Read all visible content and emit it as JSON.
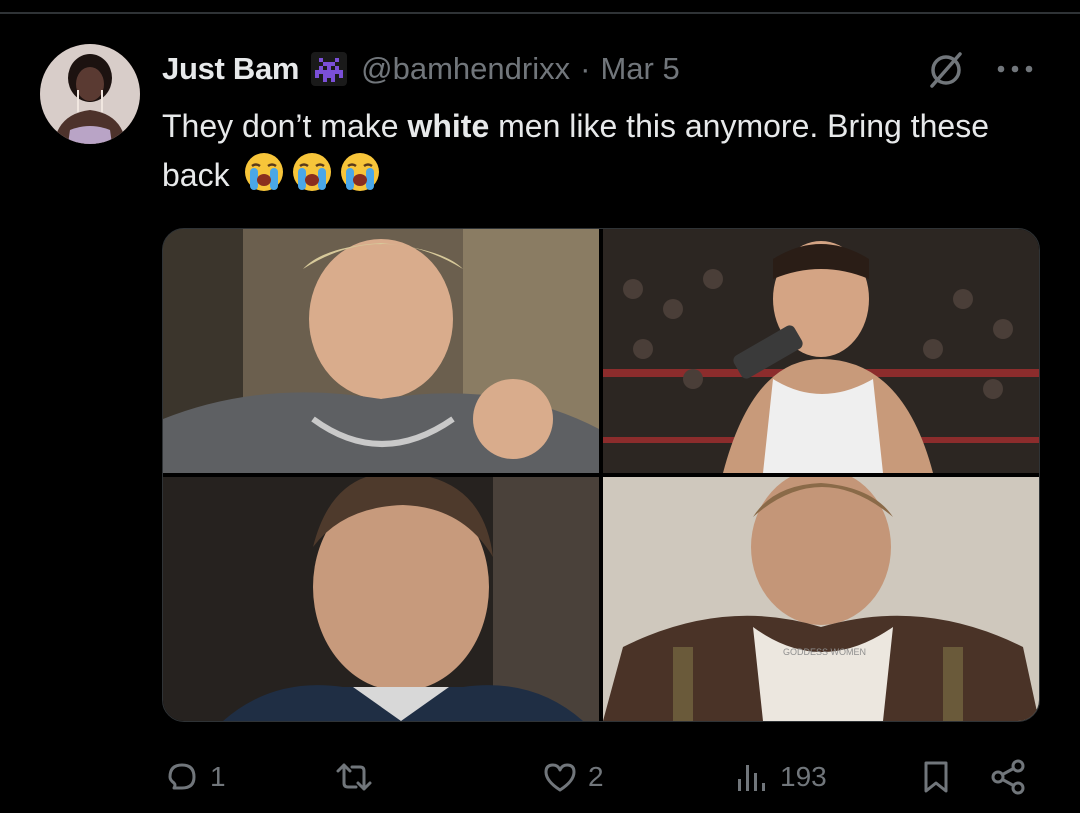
{
  "tweet": {
    "author": {
      "display_name": "Just Bam",
      "badge_icon": "space-invader-icon",
      "handle": "@bamhendrixx",
      "separator": "·",
      "date": "Mar 5"
    },
    "text": {
      "part1": "They don’t make ",
      "bold": "white",
      "part2": " men like this anymore. Bring these back",
      "emojis": [
        "loudly-crying-face",
        "loudly-crying-face",
        "loudly-crying-face"
      ]
    },
    "media": {
      "count": 4,
      "watermark": "GODDESS WOMEN"
    },
    "actions": {
      "replies": "1",
      "reposts": "",
      "likes": "2",
      "views": "193"
    }
  },
  "colors": {
    "background": "#000000",
    "text_primary": "#e7e9ea",
    "text_secondary": "#71767b",
    "badge_purple": "#6e3fc7",
    "divider": "#2f3336"
  }
}
